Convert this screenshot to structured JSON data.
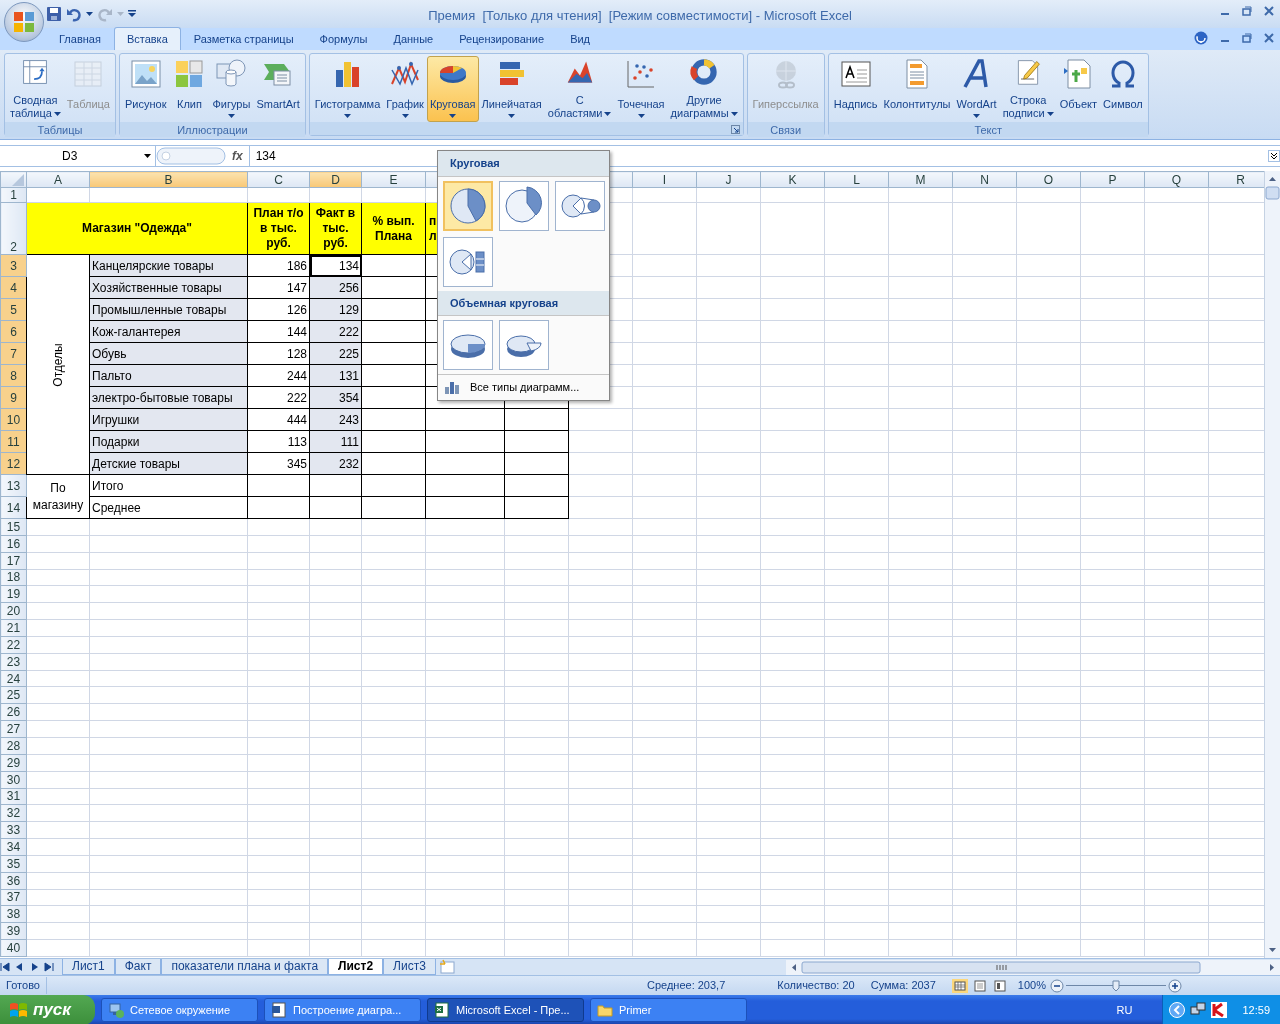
{
  "window": {
    "title": "Премия  [Только для чтения]  [Режим совместимости] - Microsoft Excel"
  },
  "ribbon_tabs": [
    {
      "label": "Главная",
      "selected": false
    },
    {
      "label": "Вставка",
      "selected": true
    },
    {
      "label": "Разметка страницы",
      "selected": false
    },
    {
      "label": "Формулы",
      "selected": false
    },
    {
      "label": "Данные",
      "selected": false
    },
    {
      "label": "Рецензирование",
      "selected": false
    },
    {
      "label": "Вид",
      "selected": false
    }
  ],
  "ribbon_groups": [
    {
      "label": "Таблицы",
      "buttons": [
        {
          "label": "Сводная\nтаблица",
          "dropdown": true,
          "disabled": false,
          "pressed": false
        },
        {
          "label": "Таблица",
          "disabled": true,
          "pressed": false
        }
      ]
    },
    {
      "label": "Иллюстрации",
      "buttons": [
        {
          "label": "Рисунок",
          "disabled": false,
          "pressed": false
        },
        {
          "label": "Клип",
          "disabled": false,
          "pressed": false
        },
        {
          "label": "Фигуры",
          "dropdown": true,
          "disabled": false,
          "pressed": false
        },
        {
          "label": "SmartArt",
          "disabled": false,
          "pressed": false
        }
      ]
    },
    {
      "launcher": true,
      "buttons": [
        {
          "label": "Гистограмма",
          "dropdown": true,
          "disabled": false,
          "pressed": false
        },
        {
          "label": "График",
          "dropdown": true,
          "disabled": false,
          "pressed": false
        },
        {
          "label": "Круговая",
          "dropdown": true,
          "disabled": false,
          "pressed": true
        },
        {
          "label": "Линейчатая",
          "dropdown": true,
          "disabled": false,
          "pressed": false
        },
        {
          "label": "С\nобластями",
          "dropdown": true,
          "disabled": false,
          "pressed": false
        },
        {
          "label": "Точечная",
          "dropdown": true,
          "disabled": false,
          "pressed": false
        },
        {
          "label": "Другие\nдиаграммы",
          "dropdown": true,
          "disabled": false,
          "pressed": false
        }
      ]
    },
    {
      "label": "Связи",
      "buttons": [
        {
          "label": "Гиперссылка",
          "disabled": true,
          "pressed": false
        }
      ]
    },
    {
      "label": "Текст",
      "buttons": [
        {
          "label": "Надпись",
          "disabled": false,
          "pressed": false
        },
        {
          "label": "Колонтитулы",
          "disabled": false,
          "pressed": false
        },
        {
          "label": "WordArt",
          "dropdown": true,
          "disabled": false,
          "pressed": false
        },
        {
          "label": "Строка\nподписи",
          "dropdown": true,
          "disabled": false,
          "pressed": false
        },
        {
          "label": "Объект",
          "disabled": false,
          "pressed": false
        },
        {
          "label": "Символ",
          "disabled": false,
          "pressed": false
        }
      ]
    }
  ],
  "formula_bar": {
    "name_box": "D3",
    "function_button": "fx",
    "formula": "134"
  },
  "sheet": {
    "columns": [
      {
        "label": "A",
        "selected": false
      },
      {
        "label": "B",
        "selected": true
      },
      {
        "label": "C",
        "selected": false
      },
      {
        "label": "D",
        "selected": true
      },
      {
        "label": "E",
        "selected": false
      },
      {
        "label": "I",
        "selected": false
      },
      {
        "label": "J",
        "selected": false
      },
      {
        "label": "K",
        "selected": false
      },
      {
        "label": "L",
        "selected": false
      },
      {
        "label": "M",
        "selected": false
      },
      {
        "label": "N",
        "selected": false
      },
      {
        "label": "O",
        "selected": false
      },
      {
        "label": "P",
        "selected": false
      },
      {
        "label": "Q",
        "selected": false
      },
      {
        "label": "R",
        "selected": false
      }
    ],
    "row_headers": [
      {
        "label": "1",
        "selected": false
      },
      {
        "label": "2",
        "selected": false
      },
      {
        "label": "3",
        "selected": true
      },
      {
        "label": "4",
        "selected": true
      },
      {
        "label": "5",
        "selected": true
      },
      {
        "label": "6",
        "selected": true
      },
      {
        "label": "7",
        "selected": true
      },
      {
        "label": "8",
        "selected": true
      },
      {
        "label": "9",
        "selected": true
      },
      {
        "label": "10",
        "selected": true
      },
      {
        "label": "11",
        "selected": true
      },
      {
        "label": "12",
        "selected": true
      },
      {
        "label": "13",
        "selected": false
      },
      {
        "label": "14",
        "selected": false
      },
      {
        "label": "15",
        "selected": false
      },
      {
        "label": "16",
        "selected": false
      },
      {
        "label": "17",
        "selected": false
      },
      {
        "label": "18",
        "selected": false
      },
      {
        "label": "19",
        "selected": false
      },
      {
        "label": "20",
        "selected": false
      },
      {
        "label": "21",
        "selected": false
      },
      {
        "label": "22",
        "selected": false
      },
      {
        "label": "23",
        "selected": false
      },
      {
        "label": "24",
        "selected": false
      },
      {
        "label": "25",
        "selected": false
      },
      {
        "label": "26",
        "selected": false
      },
      {
        "label": "27",
        "selected": false
      },
      {
        "label": "28",
        "selected": false
      },
      {
        "label": "29",
        "selected": false
      },
      {
        "label": "30",
        "selected": false
      },
      {
        "label": "31",
        "selected": false
      },
      {
        "label": "32",
        "selected": false
      },
      {
        "label": "33",
        "selected": false
      },
      {
        "label": "34",
        "selected": false
      },
      {
        "label": "35",
        "selected": false
      },
      {
        "label": "36",
        "selected": false
      },
      {
        "label": "37",
        "selected": false
      },
      {
        "label": "38",
        "selected": false
      },
      {
        "label": "39",
        "selected": false
      },
      {
        "label": "40",
        "selected": false
      }
    ],
    "title_cell": "Магазин \"Одежда\"",
    "headers": [
      "План т/о в тыс. руб.",
      "Факт в тыс. руб.",
      "% вып. Плана",
      "п\nл"
    ],
    "group_label": "Отделы",
    "items": [
      {
        "name": "Канцелярские товары",
        "plan": "186",
        "fact": "134",
        "selected": true,
        "active": true
      },
      {
        "name": "Хозяйственные товары",
        "plan": "147",
        "fact": "256",
        "selected": true,
        "active": false
      },
      {
        "name": "Промышленные товары",
        "plan": "126",
        "fact": "129",
        "selected": true,
        "active": false
      },
      {
        "name": "Кож-галантерея",
        "plan": "144",
        "fact": "222",
        "selected": true,
        "active": false
      },
      {
        "name": "Обувь",
        "plan": "128",
        "fact": "225",
        "selected": true,
        "active": false
      },
      {
        "name": "Пальто",
        "plan": "244",
        "fact": "131",
        "selected": true,
        "active": false
      },
      {
        "name": "электро-бытовые товары",
        "plan": "222",
        "fact": "354",
        "selected": true,
        "active": false
      },
      {
        "name": "Игрушки",
        "plan": "444",
        "fact": "243",
        "selected": true,
        "active": false
      },
      {
        "name": "Подарки",
        "plan": "113",
        "fact": "111",
        "selected": true,
        "active": false
      },
      {
        "name": "Детские товары",
        "plan": "345",
        "fact": "232",
        "selected": true,
        "active": false
      }
    ],
    "summary_label": "По магазину",
    "summary_rows": [
      "Итого",
      "Среднее"
    ]
  },
  "chart_menu": {
    "sections": [
      {
        "title": "Круговая",
        "items": [
          {
            "selected": true
          },
          {
            "selected": false
          },
          {
            "selected": false
          },
          {
            "selected": false
          }
        ]
      },
      {
        "title": "Объемная круговая",
        "items": [
          {
            "selected": false
          },
          {
            "selected": false
          }
        ]
      }
    ],
    "footer": "Все типы диаграмм..."
  },
  "sheet_tabs": [
    {
      "label": "Лист1",
      "selected": false
    },
    {
      "label": "Факт",
      "selected": false
    },
    {
      "label": "показатели плана и факта",
      "selected": false
    },
    {
      "label": "Лист2",
      "selected": true
    },
    {
      "label": "Лист3",
      "selected": false
    }
  ],
  "status_bar": {
    "state": "Готово",
    "average": "Среднее: 203,7",
    "count": "Количество: 20",
    "sum": "Сумма: 2037",
    "zoom": "100%",
    "zoom_level": {
      "level": 0.5
    }
  },
  "taskbar": {
    "start": "пуск",
    "tasks": [
      {
        "label": "Сетевое окружение",
        "selected": false
      },
      {
        "label": "Построение диагра...",
        "selected": false
      },
      {
        "label": "Microsoft Excel - Пре...",
        "selected": true
      },
      {
        "label": "Primer",
        "selected": false
      }
    ],
    "language": "RU",
    "clock": "12:59"
  }
}
